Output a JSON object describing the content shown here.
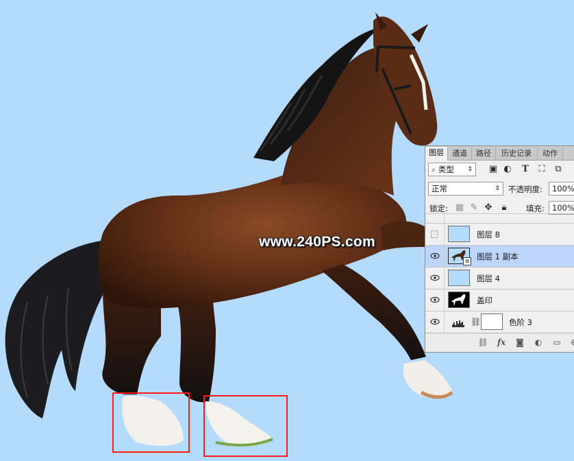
{
  "canvas": {
    "background_color": "#b4dafc",
    "watermark": "www.240PS.com",
    "selection_color": "#ff1a1a"
  },
  "layers_panel": {
    "tabs": [
      "图层",
      "通道",
      "路径",
      "历史记录",
      "动作"
    ],
    "active_tab": "图层",
    "filter": {
      "search_icon": "search-icon",
      "kind_label": "类型"
    },
    "blend_mode": "正常",
    "opacity_label": "不透明度:",
    "opacity_value": "100%",
    "lock_label": "锁定:",
    "fill_label": "填充:",
    "fill_value": "100%",
    "layers": [
      {
        "name": "图层 8",
        "visible": false,
        "selected": false,
        "thumb": "light-blue"
      },
      {
        "name": "图层 1 副本",
        "visible": true,
        "selected": true,
        "thumb": "horse"
      },
      {
        "name": "图层 4",
        "visible": true,
        "selected": false,
        "thumb": "light-blue"
      },
      {
        "name": "盖印",
        "visible": true,
        "selected": false,
        "thumb": "silhouette"
      },
      {
        "name": "色阶 3",
        "visible": true,
        "selected": false,
        "thumb": "levels-adjustment"
      }
    ],
    "footer_icons": [
      "link-icon",
      "fx-icon",
      "mask-icon",
      "adjustment-icon",
      "folder-icon",
      "new-layer-icon"
    ]
  }
}
